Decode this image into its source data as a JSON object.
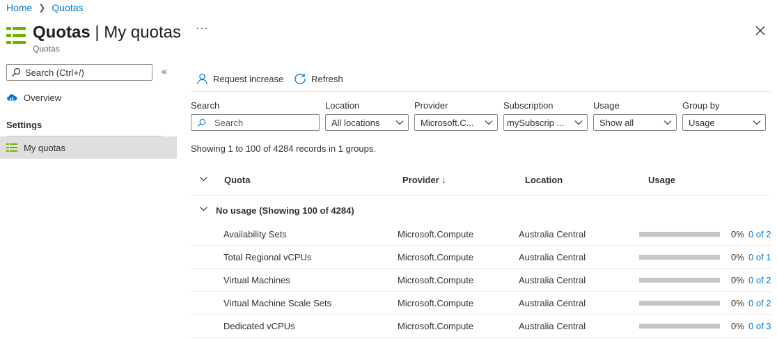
{
  "breadcrumb": {
    "home": "Home",
    "current": "Quotas"
  },
  "header": {
    "title_bold": "Quotas",
    "title_rest": " | My quotas",
    "subtitle": "Quotas",
    "more": "···"
  },
  "sidebar": {
    "search_placeholder": "Search (Ctrl+/)",
    "overview": "Overview",
    "settings_heading": "Settings",
    "my_quotas": "My quotas"
  },
  "toolbar": {
    "request_increase": "Request increase",
    "refresh": "Refresh"
  },
  "filters": {
    "search_label": "Search",
    "search_placeholder": "Search",
    "location_label": "Location",
    "location_value": "All locations",
    "provider_label": "Provider",
    "provider_value": "Microsoft.C...",
    "subscription_label": "Subscription",
    "subscription_value": "mySubscrip ...",
    "usage_label": "Usage",
    "usage_value": "Show all",
    "groupby_label": "Group by",
    "groupby_value": "Usage"
  },
  "records_text": "Showing 1 to 100 of 4284 records in 1 groups.",
  "table": {
    "col_quota": "Quota",
    "col_provider": "Provider ↓",
    "col_location": "Location",
    "col_usage": "Usage",
    "group_label": "No usage (Showing 100 of 4284)",
    "rows": [
      {
        "quota": "Availability Sets",
        "provider": "Microsoft.Compute",
        "location": "Australia Central",
        "usage_fraction": 0,
        "pct": "0%",
        "usage_link": "0 of 2"
      },
      {
        "quota": "Total Regional vCPUs",
        "provider": "Microsoft.Compute",
        "location": "Australia Central",
        "usage_fraction": 0,
        "pct": "0%",
        "usage_link": "0 of 1"
      },
      {
        "quota": "Virtual Machines",
        "provider": "Microsoft.Compute",
        "location": "Australia Central",
        "usage_fraction": 0,
        "pct": "0%",
        "usage_link": "0 of 2"
      },
      {
        "quota": "Virtual Machine Scale Sets",
        "provider": "Microsoft.Compute",
        "location": "Australia Central",
        "usage_fraction": 0,
        "pct": "0%",
        "usage_link": "0 of 2"
      },
      {
        "quota": "Dedicated vCPUs",
        "provider": "Microsoft.Compute",
        "location": "Australia Central",
        "usage_fraction": 0,
        "pct": "0%",
        "usage_link": "0 of 3"
      }
    ]
  },
  "colors": {
    "accent": "#0078d4",
    "brand_green": "#6bb700",
    "bar_track": "#c8c6c4",
    "selected_bg": "#e1dfdd"
  },
  "icons": [
    "quotas-icon",
    "more-icon",
    "close-icon",
    "search-icon",
    "collapse-icon",
    "cloud-icon",
    "person-icon",
    "refresh-icon",
    "chevron-down-icon",
    "sort-down-icon"
  ]
}
